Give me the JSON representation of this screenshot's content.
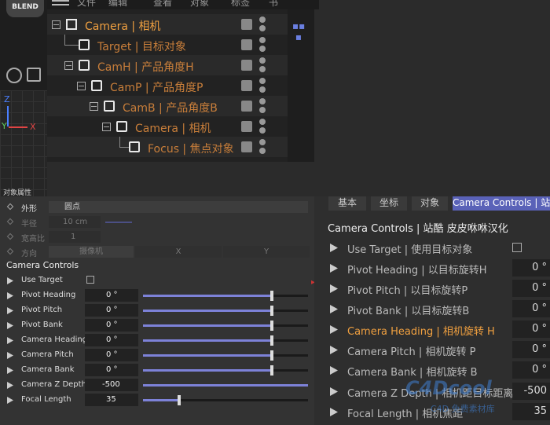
{
  "app": {
    "logo": "BLEND"
  },
  "menu": [
    "文件",
    "编辑",
    "查看",
    "对象",
    "标签",
    "书"
  ],
  "tree": [
    {
      "label": "Camera | 相机",
      "indent": 0
    },
    {
      "label": "Target | 目标对象",
      "indent": 1
    },
    {
      "label": "CamH | 产品角度H",
      "indent": 1
    },
    {
      "label": "CamP | 产品角度P",
      "indent": 2
    },
    {
      "label": "CamB | 产品角度B",
      "indent": 3
    },
    {
      "label": "Camera | 相机",
      "indent": 4
    },
    {
      "label": "Focus | 焦点对象",
      "indent": 5
    }
  ],
  "axes": {
    "z": "Z",
    "y": "Y",
    "x": "X"
  },
  "left_dim": {
    "shape_label": "外形",
    "shape_value": "圆点",
    "radius_label": "半径",
    "radius_value": "10 cm",
    "aspect_label": "宽高比",
    "aspect_value": "1",
    "direction_label": "方向",
    "direction_value": "摄像机",
    "dir_x": "X",
    "dir_y": "Y",
    "header_partial": "对象属性"
  },
  "left": {
    "section": "Camera Controls",
    "rows": [
      {
        "label": "Use Target",
        "value": "",
        "kind": "check"
      },
      {
        "label": "Pivot Heading",
        "value": "0 °",
        "fill": 0.78
      },
      {
        "label": "Pivot Pitch",
        "value": "0 °",
        "fill": 0.78
      },
      {
        "label": "Pivot Bank",
        "value": "0 °",
        "fill": 0.78
      },
      {
        "label": "Camera Heading",
        "value": "0 °",
        "fill": 0.78
      },
      {
        "label": "Camera Pitch",
        "value": "0 °",
        "fill": 0.78
      },
      {
        "label": "Camera Bank",
        "value": "0 °",
        "fill": 0.78
      },
      {
        "label": "Camera Z Depth",
        "value": "-500",
        "fill": 1.0
      },
      {
        "label": "Focal Length",
        "value": "35",
        "fill": 0.22
      }
    ]
  },
  "right": {
    "tabs": [
      "基本",
      "坐标",
      "对象",
      "Camera Controls | 站"
    ],
    "title": "Camera Controls | 站酷 皮皮咻咻汉化",
    "rows": [
      {
        "label": "Use Target | 使用目标对象",
        "value": "",
        "kind": "check"
      },
      {
        "label": "Pivot Heading | 以目标旋转H",
        "value": "0 °"
      },
      {
        "label": "Pivot Pitch | 以目标旋转P",
        "value": "0 °"
      },
      {
        "label": "Pivot Bank | 以目标旋转B",
        "value": "0 °"
      },
      {
        "label": "Camera Heading | 相机旋转 H",
        "value": "0 °",
        "highlight": true
      },
      {
        "label": "Camera Pitch | 相机旋转 P",
        "value": "0 °"
      },
      {
        "label": "Camera Bank | 相机旋转 B",
        "value": "0 °"
      },
      {
        "label": "Camera Z Depth | 相机距目标距离 Z",
        "value": "-500"
      },
      {
        "label": "Focal Length | 相机焦距",
        "value": "35"
      }
    ]
  },
  "watermark": {
    "main": "C4Dcool",
    "sub": "C4D 免费素材库"
  },
  "colors": {
    "orange": "#c87e3a",
    "accent": "#5a62b8",
    "slider": "#7d82d8"
  }
}
